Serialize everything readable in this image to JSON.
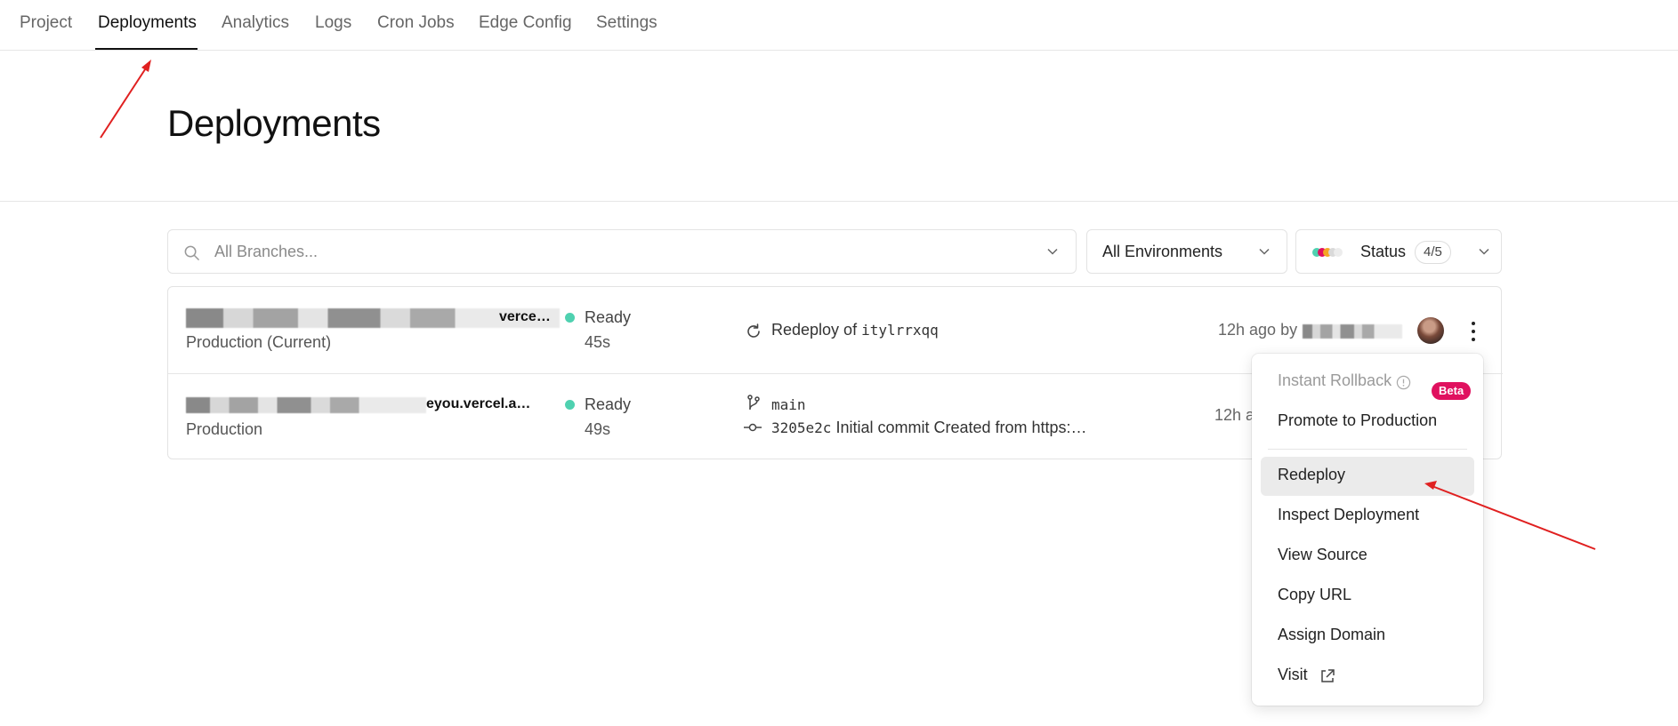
{
  "nav": {
    "tabs": [
      "Project",
      "Deployments",
      "Analytics",
      "Logs",
      "Cron Jobs",
      "Edge Config",
      "Settings"
    ],
    "active_index": 1
  },
  "page": {
    "title": "Deployments"
  },
  "filters": {
    "branch_placeholder": "All Branches...",
    "environment_value": "All Environments",
    "status_label": "Status",
    "status_count": "4/5"
  },
  "deployments": [
    {
      "url": "…vercel.a…",
      "url_visible": "verce…",
      "environment": "Production (Current)",
      "status": "Ready",
      "duration": "45s",
      "source_label": "Redeploy of",
      "source_id": "itylrrxqq",
      "time": "12h ago by"
    },
    {
      "url_visible": "eyou.vercel.a…",
      "environment": "Production",
      "status": "Ready",
      "duration": "49s",
      "branch": "main",
      "commit_hash": "3205e2c",
      "commit_message": "Initial commit Created from https:…",
      "time": "12h a"
    }
  ],
  "menu": {
    "items": [
      "Instant Rollback",
      "Promote to Production",
      "Redeploy",
      "Inspect Deployment",
      "View Source",
      "Copy URL",
      "Assign Domain",
      "Visit"
    ],
    "beta_badge": "Beta",
    "hovered": "Redeploy"
  },
  "colors": {
    "ready_dot": "#4fd1b0",
    "beta_badge": "#e0115f",
    "annotation_arrow": "#e02020"
  },
  "icons": [
    "search-icon",
    "chevron-down-icon",
    "redeploy-icon",
    "git-branch-icon",
    "git-commit-icon",
    "info-icon",
    "external-link-icon",
    "more-icon"
  ]
}
